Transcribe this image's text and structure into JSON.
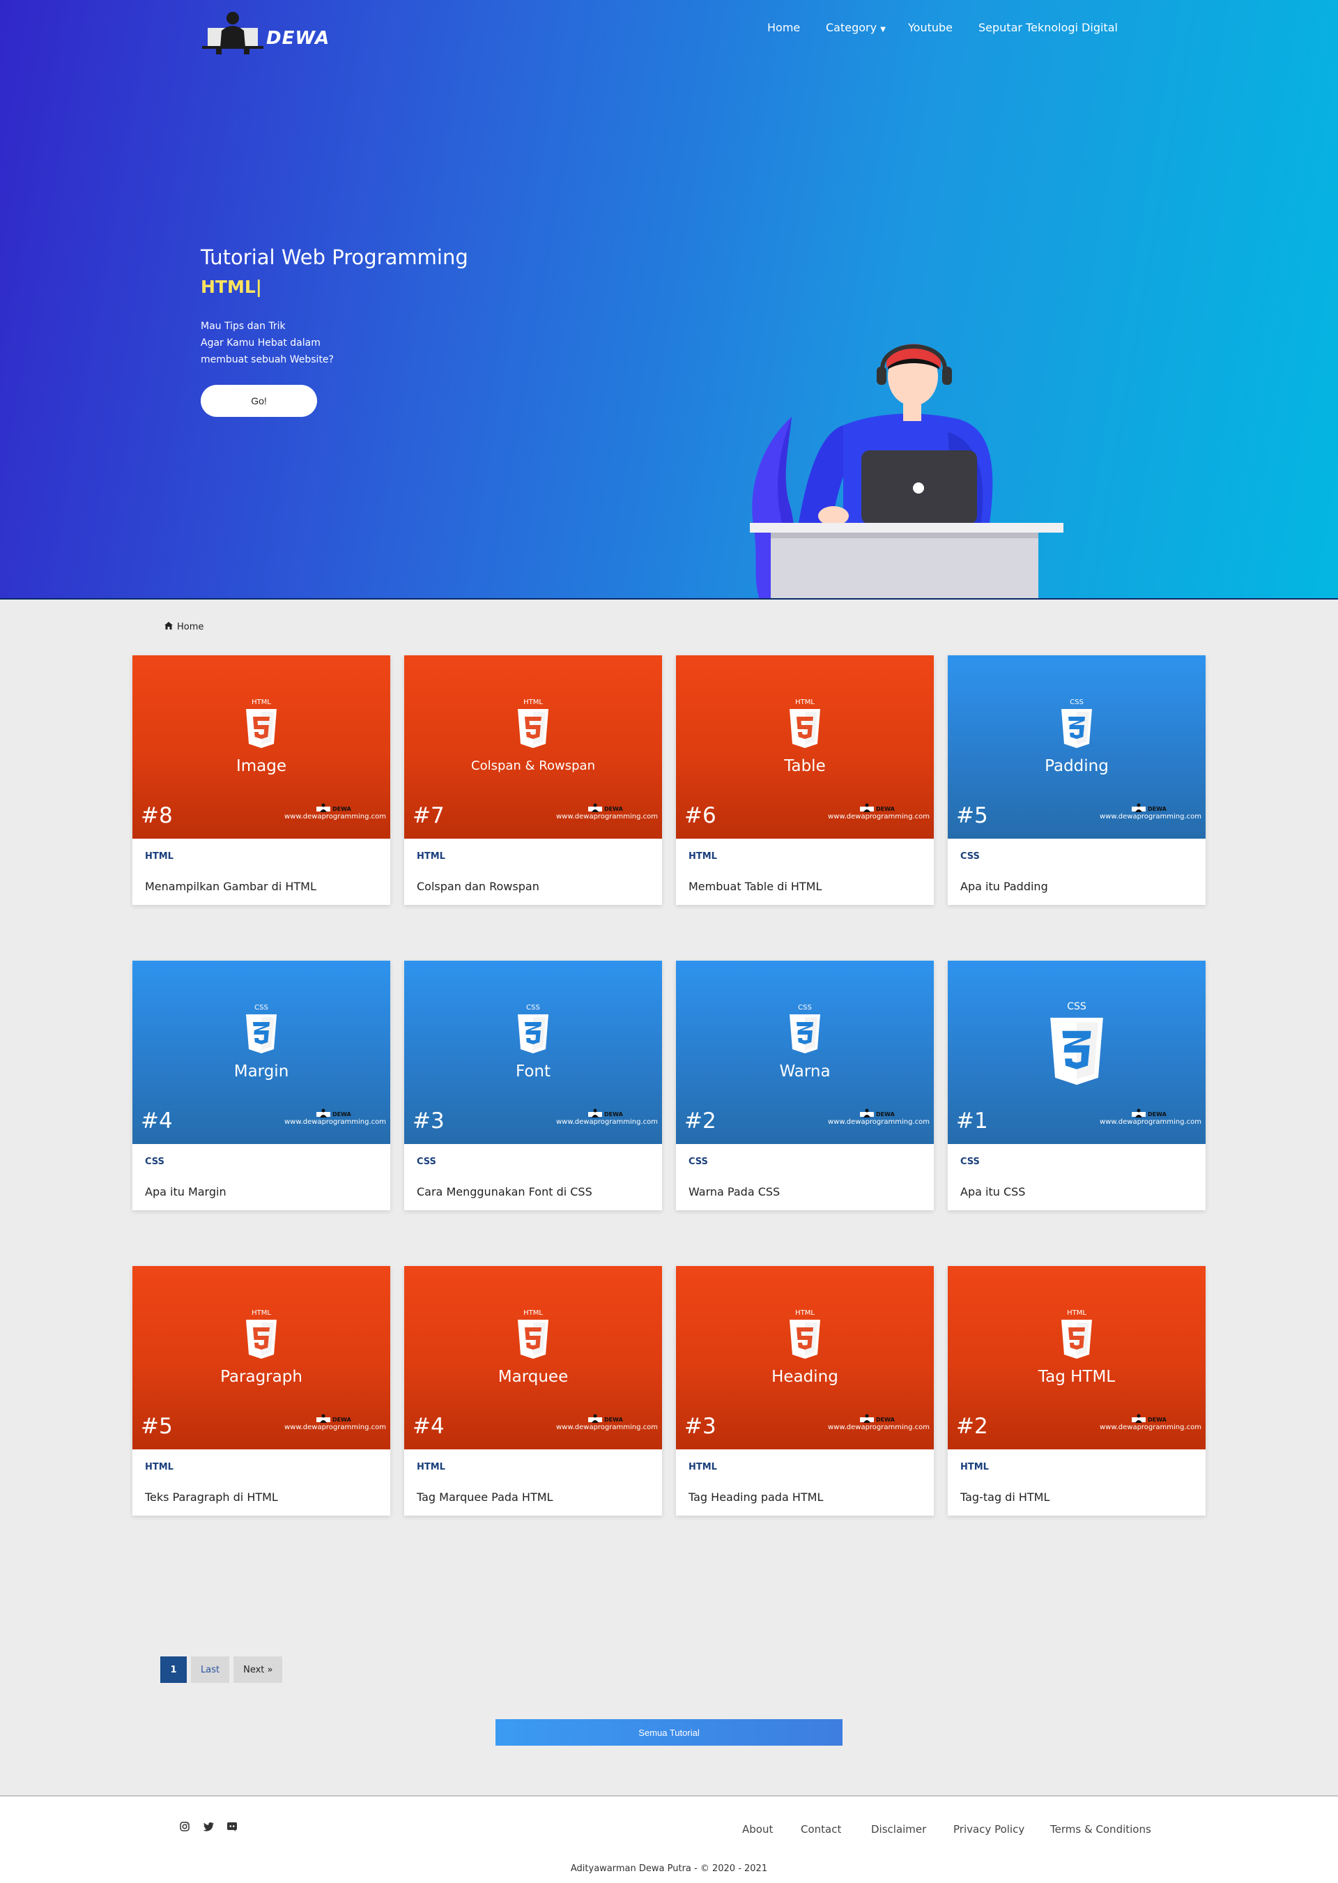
{
  "brand": {
    "logo_text": "DEWA"
  },
  "nav": {
    "home": "Home",
    "category": "Category",
    "youtube": "Youtube",
    "seputar": "Seputar Teknologi Digital"
  },
  "hero": {
    "title": "Tutorial Web Programming",
    "typed": "HTML|",
    "desc_line1": "Mau Tips dan Trik",
    "desc_line2": "Agar Kamu Hebat dalam",
    "desc_line3": "membuat sebuah Website?",
    "go_label": "Go!"
  },
  "breadcrumb": {
    "home": "Home"
  },
  "thumb_brand": "www.dewaprogramming.com",
  "mini_logo": "DEWA",
  "cards": [
    {
      "type": "html",
      "shield_label": "HTML",
      "thumb_title": "Image",
      "number": "#8",
      "category": "HTML",
      "title": "Menampilkan Gambar di HTML"
    },
    {
      "type": "html",
      "shield_label": "HTML",
      "thumb_title": "Colspan & Rowspan",
      "number": "#7",
      "category": "HTML",
      "title": "Colspan dan Rowspan"
    },
    {
      "type": "html",
      "shield_label": "HTML",
      "thumb_title": "Table",
      "number": "#6",
      "category": "HTML",
      "title": "Membuat Table di HTML"
    },
    {
      "type": "css",
      "shield_label": "CSS",
      "thumb_title": "Padding",
      "number": "#5",
      "category": "CSS",
      "title": "Apa itu Padding"
    },
    {
      "type": "css",
      "shield_label": "CSS",
      "thumb_title": "Margin",
      "number": "#4",
      "category": "CSS",
      "title": "Apa itu Margin"
    },
    {
      "type": "css",
      "shield_label": "CSS",
      "thumb_title": "Font",
      "number": "#3",
      "category": "CSS",
      "title": "Cara Menggunakan Font di CSS"
    },
    {
      "type": "css",
      "shield_label": "CSS",
      "thumb_title": "Warna",
      "number": "#2",
      "category": "CSS",
      "title": "Warna Pada CSS"
    },
    {
      "type": "css",
      "shield_label": "CSS",
      "thumb_title": "",
      "number": "#1",
      "category": "CSS",
      "title": "Apa itu CSS"
    },
    {
      "type": "html",
      "shield_label": "HTML",
      "thumb_title": "Paragraph",
      "number": "#5",
      "category": "HTML",
      "title": "Teks Paragraph di HTML"
    },
    {
      "type": "html",
      "shield_label": "HTML",
      "thumb_title": "Marquee",
      "number": "#4",
      "category": "HTML",
      "title": "Tag Marquee Pada HTML"
    },
    {
      "type": "html",
      "shield_label": "HTML",
      "thumb_title": "Heading",
      "number": "#3",
      "category": "HTML",
      "title": "Tag Heading pada HTML"
    },
    {
      "type": "html",
      "shield_label": "HTML",
      "thumb_title": "Tag HTML",
      "number": "#2",
      "category": "HTML",
      "title": "Tag-tag di HTML"
    }
  ],
  "pagination": {
    "current": "1",
    "last": "Last",
    "next": "Next »"
  },
  "all_button": "Semua Tutorial",
  "footer": {
    "social_icons": [
      "instagram-icon",
      "twitter-icon",
      "discord-icon"
    ],
    "about": "About",
    "contact": "Contact",
    "disclaimer": "Disclaimer",
    "privacy": "Privacy Policy",
    "terms": "Terms & Conditions",
    "copyright": "Adityawarman Dewa Putra - © 2020 - 2021"
  },
  "colors": {
    "html_thumb": "#e2400f",
    "css_thumb": "#2a80d2",
    "accent": "#1c4d8c",
    "typed": "#ffe45c"
  }
}
